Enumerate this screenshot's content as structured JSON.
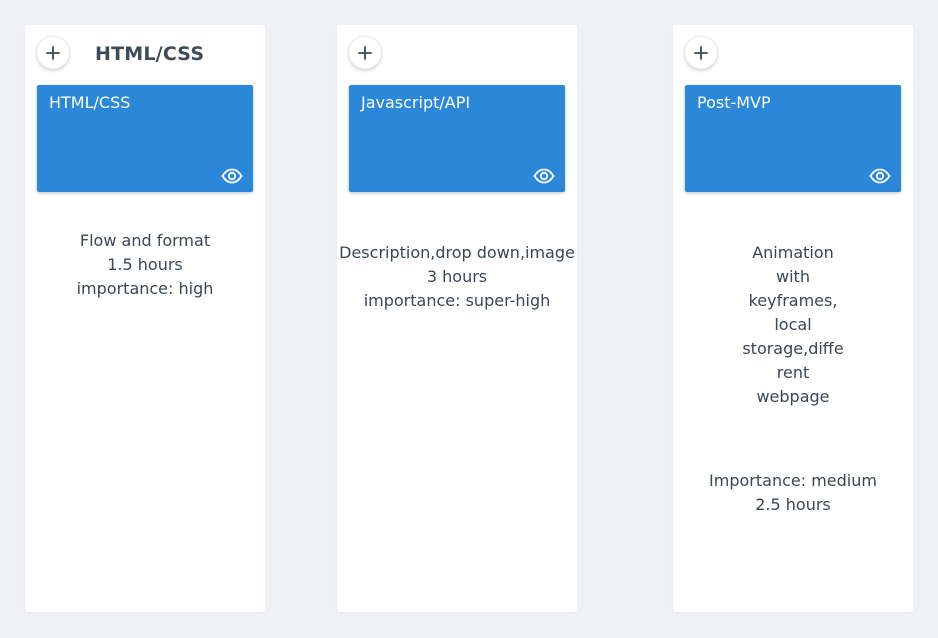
{
  "columns": [
    {
      "header_title": "HTML/CSS",
      "card": {
        "title": "HTML/CSS"
      },
      "description_lines": [
        "Flow and format",
        "1.5 hours",
        "importance: high"
      ]
    },
    {
      "header_title": "",
      "card": {
        "title": "Javascript/API"
      },
      "description_lines": [
        "Description,drop down,image",
        "3 hours",
        "importance: super-high"
      ]
    },
    {
      "header_title": "",
      "card": {
        "title": "Post-MVP"
      },
      "description_lines": [
        "Animation",
        "with",
        "keyframes,",
        "local",
        "storage,diffe",
        "rent",
        "webpage"
      ],
      "description_lines_2": [
        "Importance: medium",
        "2.5 hours"
      ]
    }
  ],
  "icons": {
    "add": "plus-icon",
    "view": "eye-icon"
  },
  "colors": {
    "background": "#f0f1f4",
    "card": "#2b87d8",
    "text": "#3b4656"
  }
}
